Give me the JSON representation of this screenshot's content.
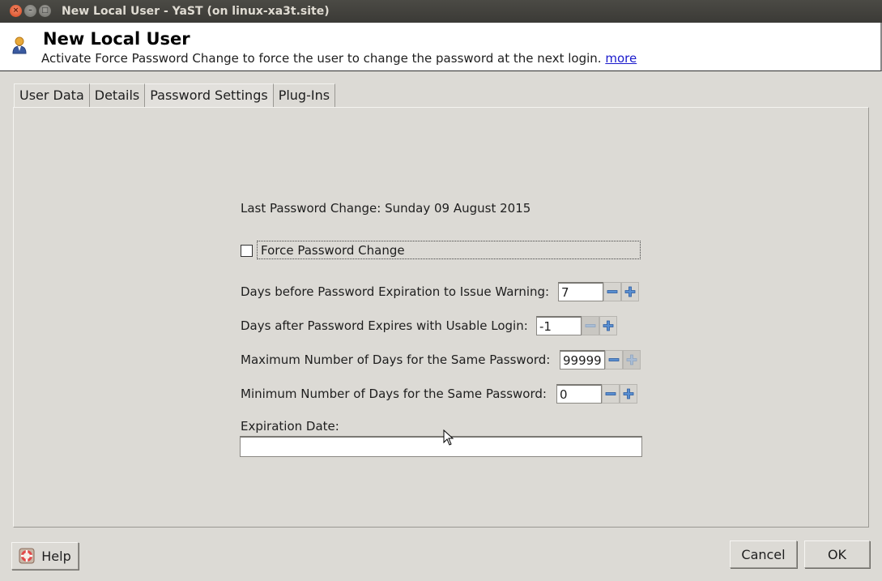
{
  "window": {
    "title": "New Local User - YaST (on linux-xa3t.site)",
    "controls": [
      "close",
      "minimize",
      "maximize"
    ]
  },
  "header": {
    "icon": "user-icon",
    "title": "New Local User",
    "description": "Activate Force Password Change to force the user to change the password at the next login.",
    "more_link": "more"
  },
  "tabs": [
    {
      "label": "User Data",
      "active": false
    },
    {
      "label": "Details",
      "active": false
    },
    {
      "label": "Password Settings",
      "active": true
    },
    {
      "label": "Plug-Ins",
      "active": false
    }
  ],
  "password_settings": {
    "last_change_label": "Last Password Change: Sunday 09 August 2015",
    "force_change": {
      "label": "Force Password Change",
      "checked": false
    },
    "fields": [
      {
        "label": "Days before Password Expiration to Issue Warning:",
        "value": "7",
        "minus_enabled": true,
        "plus_enabled": true
      },
      {
        "label": "Days after Password Expires with Usable Login:",
        "value": "-1",
        "minus_enabled": false,
        "plus_enabled": true
      },
      {
        "label": "Maximum Number of Days for the Same Password:",
        "value": "99999",
        "minus_enabled": true,
        "plus_enabled": false
      },
      {
        "label": "Minimum Number of Days for the Same Password:",
        "value": "0",
        "minus_enabled": true,
        "plus_enabled": true
      }
    ],
    "expiration_date": {
      "label": "Expiration Date:",
      "value": ""
    }
  },
  "buttons": {
    "help": "Help",
    "cancel": "Cancel",
    "ok": "OK"
  }
}
